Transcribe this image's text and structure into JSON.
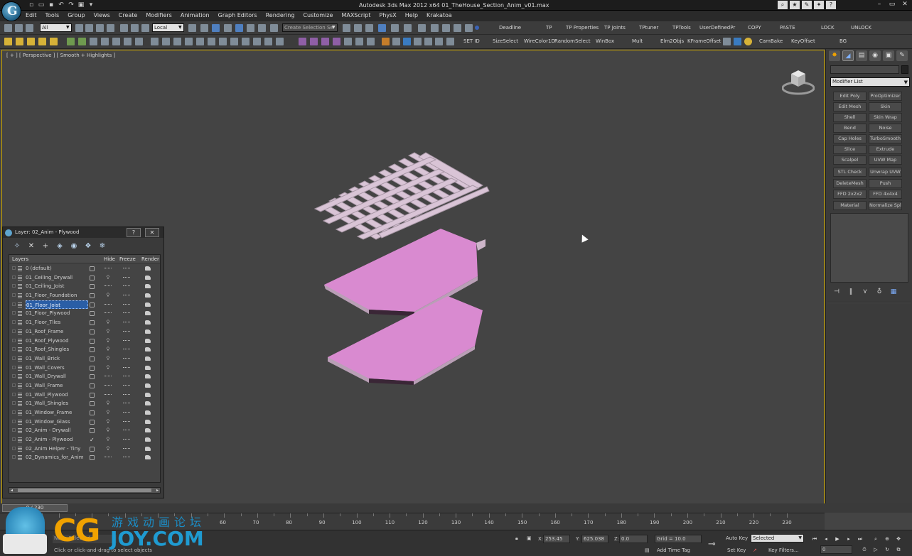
{
  "app": {
    "title": "Autodesk 3ds Max 2012 x64    01_TheHouse_Section_Anim_v01.max",
    "logo_letter": "G"
  },
  "quick_access_icons": [
    "new-icon",
    "open-icon",
    "save-icon",
    "undo-icon",
    "redo-icon",
    "project-icon",
    "arrow-icon"
  ],
  "help_icons": [
    "search",
    "star",
    "tools",
    "bookmark",
    "help"
  ],
  "window_controls": [
    "–",
    "▭",
    "✕"
  ],
  "menu": [
    "Edit",
    "Tools",
    "Group",
    "Views",
    "Create",
    "Modifiers",
    "Animation",
    "Graph Editors",
    "Rendering",
    "Customize",
    "MAXScript",
    "PhysX",
    "Help",
    "Krakatoa"
  ],
  "toolbar1": {
    "selection_filter": "All",
    "coordinate_system": "Local",
    "selection_set_placeholder": "Create Selection Se",
    "labels": [
      "Deadline",
      "TP",
      "TP Properties",
      "TP Joints",
      "TPtuner",
      "TPTools",
      "UserDefinedPr",
      "COPY",
      "PASTE",
      "LOCK",
      "UNLOCK"
    ]
  },
  "toolbar2": {
    "labels": [
      "SET ID",
      "SizeSelect",
      "WireColor1D",
      "RandomSelect",
      "WinBox",
      "Mult",
      "Elm2Objs",
      "KFrameOffset",
      "CamBake",
      "KeyOffset",
      "BG"
    ]
  },
  "viewport": {
    "label": "[ + ] [ Perspective ] [ Smooth + Highlights ]",
    "plywood_color": "#d98ad0",
    "joist_color": "#d9c4d6"
  },
  "command_panel": {
    "tabs": [
      "create",
      "modify",
      "hierarchy",
      "motion",
      "display",
      "utilities"
    ],
    "modifier_list": "Modifier List",
    "modifier_buttons": [
      [
        "Edit Poly",
        "ProOptimizer"
      ],
      [
        "Edit Mesh",
        "Skin"
      ],
      [
        "Shell",
        "Skin Wrap"
      ],
      [
        "Bend",
        "Noise"
      ],
      [
        "Cap Holes",
        "TurboSmooth"
      ],
      [
        "Slice",
        "Extrude"
      ],
      [
        "Scalpel",
        "UVW Map"
      ],
      [
        "STL Check",
        "Unwrap UVW"
      ],
      [
        "DeleteMesh",
        "Push"
      ],
      [
        "FFD 2x2x2",
        "FFD 4x4x4"
      ],
      [
        "Material",
        "Normalize Spl."
      ]
    ]
  },
  "layer_dialog": {
    "title": "Layer: 02_Anim - Plywood",
    "help_button": "?",
    "close_button": "✕",
    "columns": [
      "Layers",
      "Hide",
      "Freeze",
      "Render"
    ],
    "layers": [
      {
        "name": "0 (default)",
        "hidden": false,
        "current": false
      },
      {
        "name": "01_Ceiling_Drywall",
        "hidden": true,
        "current": false
      },
      {
        "name": "01_Ceiling_Joist",
        "hidden": false,
        "current": false
      },
      {
        "name": "01_Floor_Foundation",
        "hidden": true,
        "current": false
      },
      {
        "name": "01_Floor_Joist",
        "hidden": false,
        "current": false
      },
      {
        "name": "01_Floor_Plywood",
        "hidden": false,
        "current": false
      },
      {
        "name": "01_Floor_Tiles",
        "hidden": true,
        "current": false
      },
      {
        "name": "01_Roof_Frame",
        "hidden": true,
        "current": false
      },
      {
        "name": "01_Roof_Plywood",
        "hidden": true,
        "current": false
      },
      {
        "name": "01_Roof_Shingles",
        "hidden": true,
        "current": false
      },
      {
        "name": "01_Wall_Brick",
        "hidden": true,
        "current": false
      },
      {
        "name": "01_Wall_Covers",
        "hidden": true,
        "current": false
      },
      {
        "name": "01_Wall_Drywall",
        "hidden": false,
        "current": false
      },
      {
        "name": "01_Wall_Frame",
        "hidden": false,
        "current": false
      },
      {
        "name": "01_Wall_Plywood",
        "hidden": false,
        "current": false
      },
      {
        "name": "01_Wall_Shingles",
        "hidden": true,
        "current": false
      },
      {
        "name": "01_Window_Frame",
        "hidden": true,
        "current": false
      },
      {
        "name": "01_Window_Glass",
        "hidden": true,
        "current": false
      },
      {
        "name": "02_Anim - Drywall",
        "hidden": true,
        "current": false
      },
      {
        "name": "02_Anim - Plywood",
        "hidden": true,
        "current": true
      },
      {
        "name": "02_Anim Helper - Tiny",
        "hidden": true,
        "current": false
      },
      {
        "name": "02_Dynamics_for_Anim",
        "hidden": false,
        "current": false
      }
    ]
  },
  "timeslider": {
    "label": "0 / 230"
  },
  "trackbar": {
    "numbers": [
      60,
      70,
      80,
      90,
      100,
      110,
      120,
      130,
      140,
      150,
      160,
      170,
      180,
      190,
      200,
      210,
      220,
      230
    ]
  },
  "status": {
    "selection": "None Selected",
    "prompt": "Click or click-and-drag to select objects",
    "x_label": "X:",
    "x_value": "253.45",
    "y_label": "Y:",
    "y_value": "625.038",
    "z_label": "Z:",
    "z_value": "0.0",
    "grid": "Grid = 10.0",
    "add_time_tag": "Add Time Tag",
    "auto_key": "Auto Key",
    "set_key": "Set Key",
    "key_mode": "Selected",
    "key_filters": "Key Filters...",
    "frame": "0"
  },
  "watermark": {
    "cg": "CG",
    "joy": "JOY.COM",
    "chinese": "游戏动画论坛"
  }
}
